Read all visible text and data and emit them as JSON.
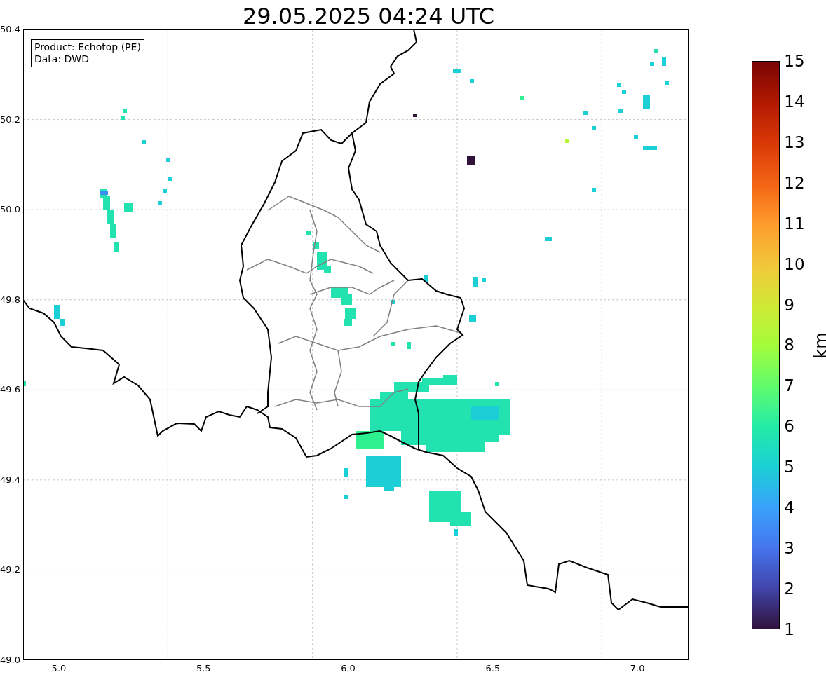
{
  "title": "29.05.2025 04:24 UTC",
  "legend": [
    "Product: Echotop (PE)",
    "Data: DWD"
  ],
  "map": {
    "x_ticks": [
      "5.0",
      "5.5",
      "6.0",
      "6.5",
      "7.0"
    ],
    "y_ticks": [
      "50.4",
      "50.2",
      "50.0",
      "49.8",
      "49.6",
      "49.4",
      "49.2",
      "49.0"
    ]
  },
  "colorbar": {
    "label": "km",
    "ticks": [
      "15",
      "14",
      "13",
      "12",
      "11",
      "10",
      "9",
      "8",
      "7",
      "6",
      "5",
      "4",
      "3",
      "2",
      "1"
    ]
  }
}
